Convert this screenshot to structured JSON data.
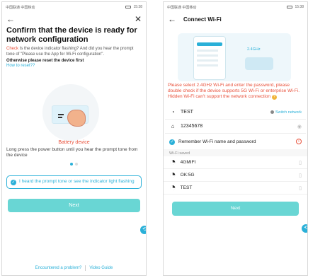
{
  "left": {
    "status": {
      "left": "中国联通 中国移动",
      "right": "15:38"
    },
    "nav": {
      "back_icon": "←",
      "close_icon": "✕"
    },
    "title": "Confirm that the device is ready for network configuration",
    "desc_red": "Check",
    "desc_rest": " Is the device indicator flashing? And did you hear the prompt tone of \"Please use the App for Wi-Fi configuration\".",
    "otherwise": "Otherwise please reset the device first",
    "reset_link": "How to reset??",
    "battery_label": "Battery device",
    "press_text": "Long press the power button until you hear the prompt tone from the device",
    "confirm_text": "I heard the prompt tone or see the indicator light flashing",
    "next": "Next",
    "encountered": "Encountered a problem?",
    "video_guide": "Video Guide",
    "colors": {
      "accent": "#2ab0d8",
      "warning": "#e8503a",
      "button": "#69d6d4"
    }
  },
  "right": {
    "status": {
      "left": "中国联通 中国移动",
      "right": "15:38"
    },
    "title": "Connect Wi-Fi",
    "ghz": "2.4GHz",
    "warning": "Please select 2.4GHz Wi-Fi and enter the password, please double check if the device supports 5G Wi-Fi or enterprise Wi-Fi.  Hidden Wi-Fi can't support the network connection",
    "ssid": "TEST",
    "switch_network": "Switch network",
    "password": "12345678",
    "remember": "Remember Wi-Fi name and password",
    "saved_label": "Wi-Fi saved",
    "saved": [
      "4GMIFI",
      "OK:5G",
      "TEST"
    ],
    "next": "Next"
  }
}
